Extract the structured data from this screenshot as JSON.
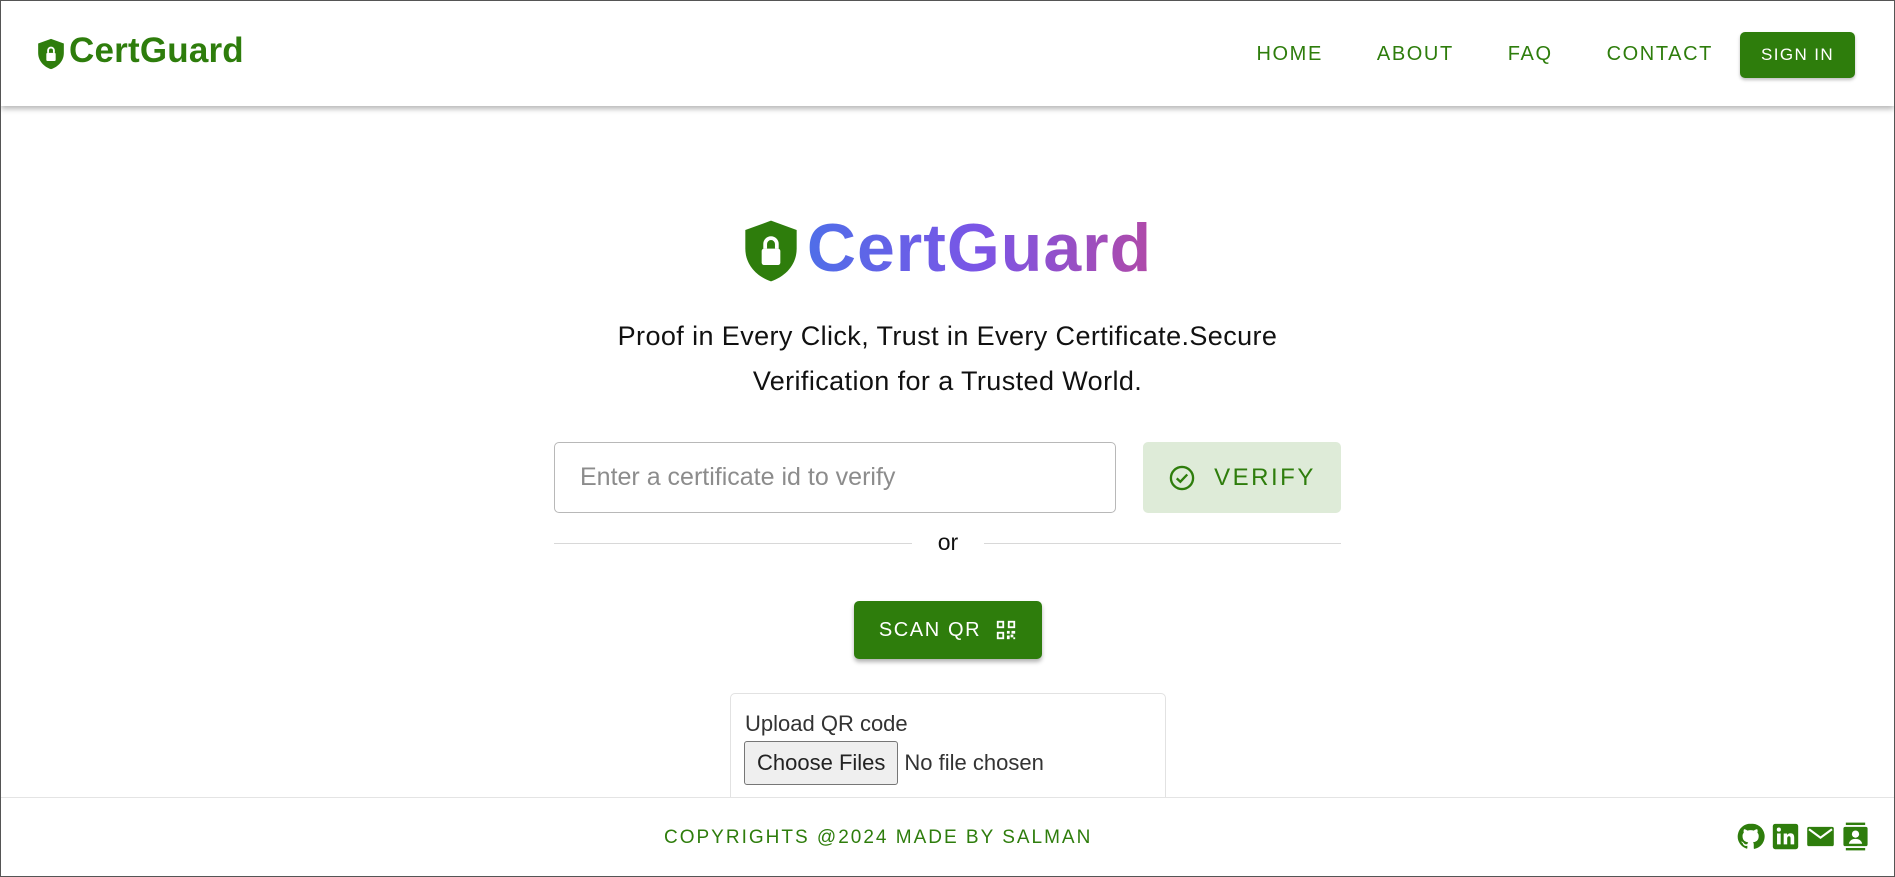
{
  "header": {
    "brand": "CertGuard",
    "nav": [
      "HOME",
      "ABOUT",
      "FAQ",
      "CONTACT"
    ],
    "signin": "SIGN IN"
  },
  "hero": {
    "title": "CertGuard",
    "tagline_line1": "Proof in Every Click, Trust in Every Certificate.Secure",
    "tagline_line2": "Verification for a Trusted World."
  },
  "verify": {
    "placeholder": "Enter a certificate id to verify",
    "button": "VERIFY",
    "divider": "or"
  },
  "scan": {
    "button": "SCAN QR"
  },
  "upload": {
    "label": "Upload QR code",
    "choose": "Choose Files",
    "status": "No file chosen"
  },
  "footer": {
    "copyright": "COPYRIGHTS @2024 MADE BY SALMAN",
    "socials": [
      "github-icon",
      "linkedin-icon",
      "email-icon",
      "contact-card-icon"
    ]
  },
  "colors": {
    "brand_green": "#2e7d0c",
    "verify_bg": "#deebd8",
    "gradient_start": "#4f6ee8",
    "gradient_end": "#b04aa8"
  }
}
